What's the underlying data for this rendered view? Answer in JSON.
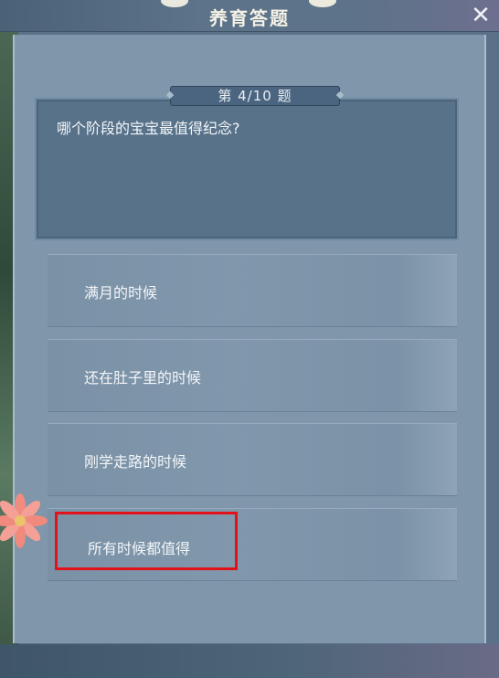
{
  "window": {
    "title": "养育答题",
    "close_label": "✕"
  },
  "quiz": {
    "counter": "第 4/10 题",
    "question": "哪个阶段的宝宝最值得纪念?",
    "options": [
      {
        "label": "满月的时候"
      },
      {
        "label": "还在肚子里的时候"
      },
      {
        "label": "刚学走路的时候"
      },
      {
        "label": "所有时候都值得"
      }
    ],
    "highlighted_option_index": 3
  },
  "colors": {
    "highlight": "#e3121a",
    "panel": "#7f96ab",
    "question_box": "#58728a"
  }
}
